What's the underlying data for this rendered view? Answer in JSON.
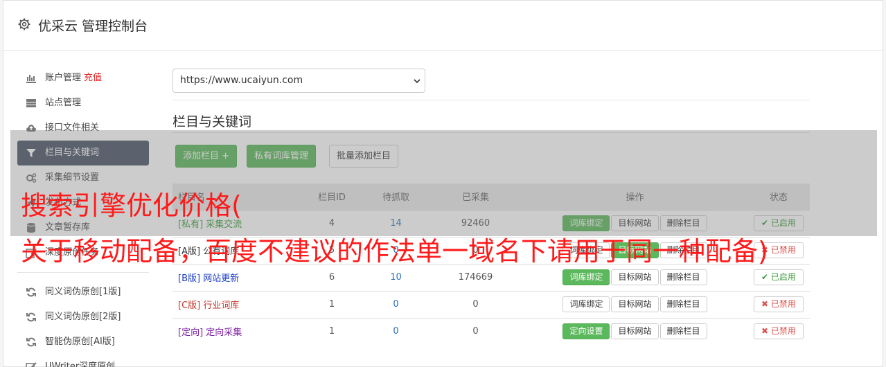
{
  "header": {
    "title": "优采云 管理控制台"
  },
  "sidebar": {
    "items": [
      {
        "label": "账户管理",
        "tag": "充值",
        "icon": "bar-chart-icon"
      },
      {
        "label": "站点管理",
        "icon": "server-icon"
      },
      {
        "label": "接口文件相关",
        "icon": "cloud-upload-icon"
      },
      {
        "label": "栏目与关键词",
        "icon": "filter-icon",
        "active": true
      },
      {
        "label": "采集细节设置",
        "icon": "cogs-icon"
      },
      {
        "label": "发布方式",
        "icon": "send-icon"
      },
      {
        "label": "文章暂存库",
        "icon": "database-icon"
      },
      {
        "label": "深度原创任务",
        "icon": "edit-icon"
      }
    ],
    "tools": [
      {
        "label": "同义词伪原创[1版]",
        "icon": "refresh-icon"
      },
      {
        "label": "同义词伪原创[2版]",
        "icon": "refresh-icon"
      },
      {
        "label": "智能伪原创[AI版]",
        "icon": "refresh-icon"
      },
      {
        "label": "UWriter深度原创",
        "icon": "pencil-icon"
      }
    ]
  },
  "main": {
    "site_select": "https://www.ucaiyun.com",
    "section_title": "栏目与关键词",
    "buttons": {
      "add_column": "添加栏目 +",
      "private_lib": "私有词库管理",
      "batch_add": "批量添加栏目"
    },
    "table": {
      "headers": [
        "栏目名",
        "栏目ID",
        "待抓取",
        "已采集",
        "操作",
        "状态"
      ],
      "rows": [
        {
          "name": "[私有] 采集交流",
          "id": "4",
          "pending": "14",
          "collected": "92460",
          "op1": "词库绑定",
          "op2": "目标网站",
          "op3": "删除栏目",
          "status": "已启用"
        },
        {
          "name": "[A版] 公有词库",
          "id": "5",
          "pending": "0",
          "collected": "0",
          "op1": "词库绑定",
          "op2": "目标网站",
          "op3": "删除栏目",
          "status": "已禁用"
        },
        {
          "name": "[B版] 网站更新",
          "id": "6",
          "pending": "10",
          "collected": "174669",
          "op1": "词库绑定",
          "op2": "目标网站",
          "op3": "删除栏目",
          "status": "已启用"
        },
        {
          "name": "[C版] 行业词库",
          "id": "1",
          "pending": "0",
          "collected": "0",
          "op1": "词库绑定",
          "op2": "目标网站",
          "op3": "删除栏目",
          "status": "已禁用"
        },
        {
          "name": "[定向] 定向采集",
          "id": "1",
          "pending": "0",
          "collected": "0",
          "op1": "定向设置",
          "op2": "目标网站",
          "op3": "删除栏目",
          "status": "已禁用"
        }
      ]
    }
  },
  "overlay": {
    "line1": "搜索引擎优化价格(",
    "line2": "关于移动配备，百度不建议的作法单一域名下请用于同一种配备)"
  }
}
